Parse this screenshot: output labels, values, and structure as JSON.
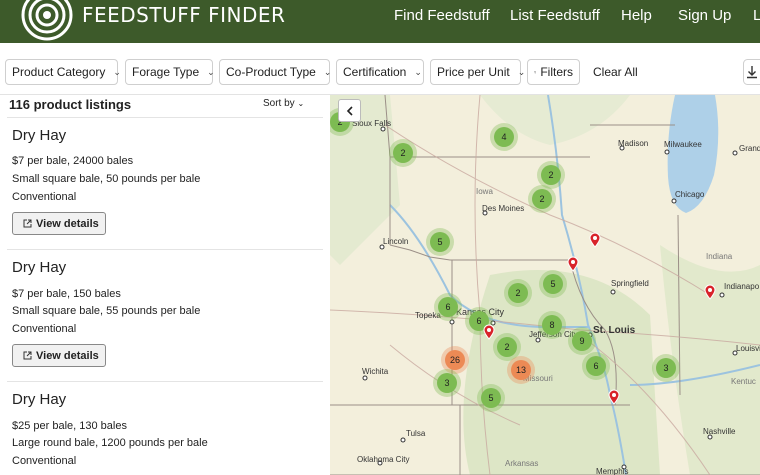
{
  "header": {
    "brand": "FEEDSTUFF FINDER",
    "nav": [
      "Find Feedstuff",
      "List Feedstuff",
      "Help",
      "Sign Up",
      "L"
    ],
    "background": "#3d5a2a"
  },
  "filters": {
    "items": [
      "Product Category",
      "Forage Type",
      "Co-Product Type",
      "Certification",
      "Price per Unit"
    ],
    "filters_label": "Filters",
    "clear_all": "Clear All",
    "download_icon": "download-icon"
  },
  "listings": {
    "count": "116 product listings",
    "sort_label": "Sort by",
    "view_label": "View details",
    "cards": [
      {
        "title": "Dry Hay",
        "price": "$7 per bale, 24000 bales",
        "desc": "Small square bale, 50 pounds per bale",
        "cert": "Conventional"
      },
      {
        "title": "Dry Hay",
        "price": "$7 per bale, 150 bales",
        "desc": "Small square bale, 55 pounds per bale",
        "cert": "Conventional"
      },
      {
        "title": "Dry Hay",
        "price": "$25 per bale, 130 bales",
        "desc": "Large round bale, 1200 pounds per bale",
        "cert": "Conventional"
      }
    ]
  },
  "map": {
    "cities": [
      "Sioux Falls",
      "Madison",
      "Milwaukee",
      "Grand",
      "Iowa",
      "Chicago",
      "Des Moines",
      "Lincoln",
      "Indiana",
      "Springfield",
      "Indianapo",
      "Topeka",
      "Kansas City",
      "Jefferson City",
      "St. Louis",
      "Missouri",
      "Louisvi",
      "Wichita",
      "Kentuc",
      "Tulsa",
      "Nashville",
      "Oklahoma City",
      "Arkansas",
      "Memphis"
    ],
    "clusters": [
      {
        "label": "2",
        "color": "green"
      },
      {
        "label": "4",
        "color": "green"
      },
      {
        "label": "2",
        "color": "green"
      },
      {
        "label": "2",
        "color": "green"
      },
      {
        "label": "2",
        "color": "green"
      },
      {
        "label": "5",
        "color": "green"
      },
      {
        "label": "2",
        "color": "green"
      },
      {
        "label": "5",
        "color": "green"
      },
      {
        "label": "6",
        "color": "green"
      },
      {
        "label": "6",
        "color": "green"
      },
      {
        "label": "8",
        "color": "green"
      },
      {
        "label": "2",
        "color": "green"
      },
      {
        "label": "9",
        "color": "green"
      },
      {
        "label": "26",
        "color": "orange"
      },
      {
        "label": "13",
        "color": "orange"
      },
      {
        "label": "6",
        "color": "green"
      },
      {
        "label": "3",
        "color": "green"
      },
      {
        "label": "3",
        "color": "green"
      },
      {
        "label": "5",
        "color": "green"
      }
    ],
    "colors": {
      "land": "#f3efdc",
      "water": "#aed0e8",
      "green_cluster": "#7dbb52",
      "orange_cluster": "#ec8a55",
      "pin": "#d8232a"
    }
  }
}
